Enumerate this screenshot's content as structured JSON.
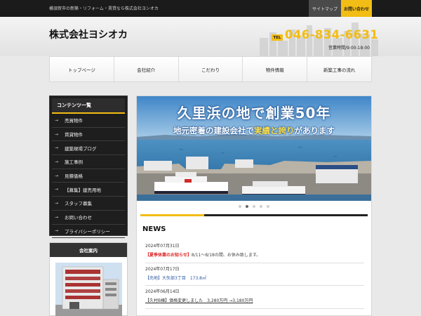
{
  "topbar": {
    "tagline": "横須賀市の新築・リフォーム・賃貸なら株式会社ヨシオカ",
    "sitemap": "サイトマップ",
    "contact": "お問い合わせ"
  },
  "header": {
    "company_name": "株式会社ヨシオカ",
    "tel_label": "TEL",
    "tel_number": "046-834-6631",
    "hours": "営業時間/9:00-18:00"
  },
  "gnav": [
    {
      "label": "トップページ"
    },
    {
      "label": "会社紹介"
    },
    {
      "label": "こだわり"
    },
    {
      "label": "物件情報"
    },
    {
      "label": "新築工事の流れ"
    }
  ],
  "sidebar": {
    "title": "コンテンツ一覧",
    "arrow": "→",
    "items": [
      {
        "label": "売買物件"
      },
      {
        "label": "賃貸物件"
      },
      {
        "label": "建築現場ブログ"
      },
      {
        "label": "施工事例"
      },
      {
        "label": "見積価格"
      },
      {
        "label": "【募集】建売用地"
      },
      {
        "label": "スタッフ募集"
      },
      {
        "label": "お問い合わせ"
      },
      {
        "label": "プライバシーポリシー"
      }
    ],
    "company_box_title": "会社案内"
  },
  "hero": {
    "headline": "久里浜の地で創業50年",
    "sub_1": "地元密着の建設会社で",
    "sub_2": "実績と誇り",
    "sub_3": "があります",
    "slides": 5,
    "active_slide": 2,
    "progress": 0.28
  },
  "news": {
    "title": "NEWS",
    "items": [
      {
        "date": "2024年07月31日",
        "tag": "【夏季休業のお知らせ】",
        "text": "8/11～8/18の間、お休み致します。",
        "style": "red"
      },
      {
        "date": "2024年07月17日",
        "tag": "",
        "text": "【売地】大矢部3丁目　173.8㎡",
        "style": "blue"
      },
      {
        "date": "2024年06月14日",
        "tag": "",
        "text": "【久村B棟】価格変更しました　3,280万円 →3,180万円",
        "style": "und"
      }
    ]
  },
  "colors": {
    "accent": "#f2bd14",
    "dark": "#1e1e1e"
  }
}
